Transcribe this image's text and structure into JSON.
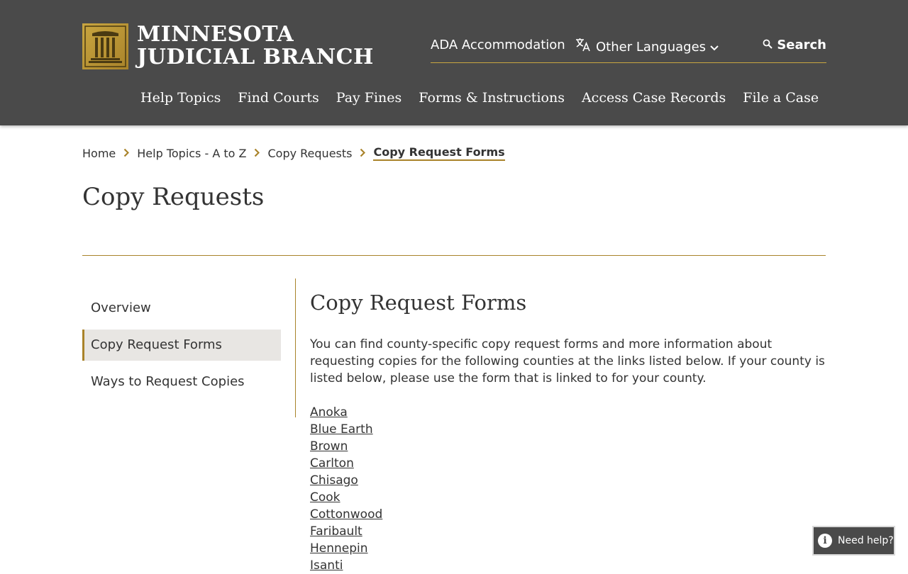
{
  "header": {
    "logo_line1": "MINNESOTA",
    "logo_line2": "JUDICIAL BRANCH",
    "utility": {
      "ada": "ADA Accommodation",
      "languages": "Other Languages",
      "search": "Search"
    },
    "nav": [
      "Help Topics",
      "Find Courts",
      "Pay Fines",
      "Forms & Instructions",
      "Access Case Records",
      "File a Case"
    ]
  },
  "breadcrumb": [
    "Home",
    "Help Topics - A to Z",
    "Copy Requests",
    "Copy Request Forms"
  ],
  "page_title": "Copy Requests",
  "sidenav": [
    "Overview",
    "Copy Request Forms",
    "Ways to Request Copies"
  ],
  "content": {
    "heading": "Copy Request Forms",
    "intro": "You can find county-specific copy request forms and more information about requesting copies for the following counties at the links listed below. If your county is listed below, please use the form that is linked to for your county.",
    "counties": [
      "Anoka",
      "Blue Earth",
      "Brown",
      "Carlton",
      "Chisago",
      "Cook",
      "Cottonwood",
      "Faribault",
      "Hennepin",
      "Isanti"
    ]
  },
  "help_widget": {
    "label": "Need help?",
    "icon_glyph": "i"
  },
  "colors": {
    "header_bg": "#4a4a4a",
    "accent_gold": "#a9832a",
    "active_bg": "#e8e6e3"
  }
}
